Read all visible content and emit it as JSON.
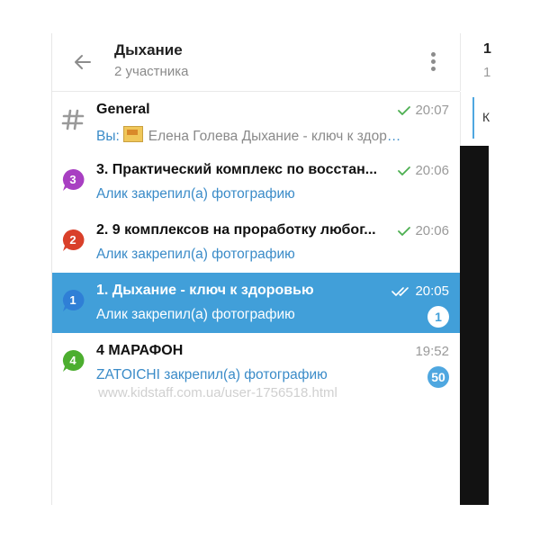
{
  "header": {
    "title": "Дыхание",
    "subtitle": "2 участника"
  },
  "chats": [
    {
      "icon": "hashtag-icon",
      "title": "General",
      "you_prefix": "Вы:",
      "subtitle": "Елена Голева Дыхание - ключ к здоровью...",
      "time": "20:07",
      "status": "single-check-icon",
      "active": false
    },
    {
      "icon": "number-3-bubble-icon",
      "icon_number": "3",
      "icon_color": "#a83fc2",
      "title": "3. Практический комплекс по восстан...",
      "subtitle": "Алик закрепил(а) фотографию",
      "time": "20:06",
      "status": "single-check-icon",
      "active": false
    },
    {
      "icon": "number-2-bubble-icon",
      "icon_number": "2",
      "icon_color": "#d9402a",
      "title": "2. 9 комплексов на проработку любог...",
      "subtitle": "Алик закрепил(а) фотографию",
      "time": "20:06",
      "status": "single-check-icon",
      "active": false
    },
    {
      "icon": "number-1-bubble-icon",
      "icon_number": "1",
      "icon_color": "#2f7fd6",
      "title": "1. Дыхание - ключ к здоровью",
      "subtitle": "Алик закрепил(а) фотографию",
      "time": "20:05",
      "status": "double-check-icon",
      "badge": "1",
      "active": true
    },
    {
      "icon": "number-4-bubble-icon",
      "icon_number": "4",
      "icon_color": "#4cae2f",
      "title": "4 МАРАФОН",
      "subtitle": "ZATOICHI закрепил(а) фотографию",
      "time": "19:52",
      "badge": "50",
      "active": false
    }
  ],
  "watermark": "www.kidstaff.com.ua/user-1756518.html",
  "right_panel": {
    "number": "1",
    "sub": "1",
    "letter": "К"
  },
  "colors": {
    "active_row": "#419fd9",
    "link_blue": "#3a8bc8",
    "check_green": "#4caf50"
  }
}
